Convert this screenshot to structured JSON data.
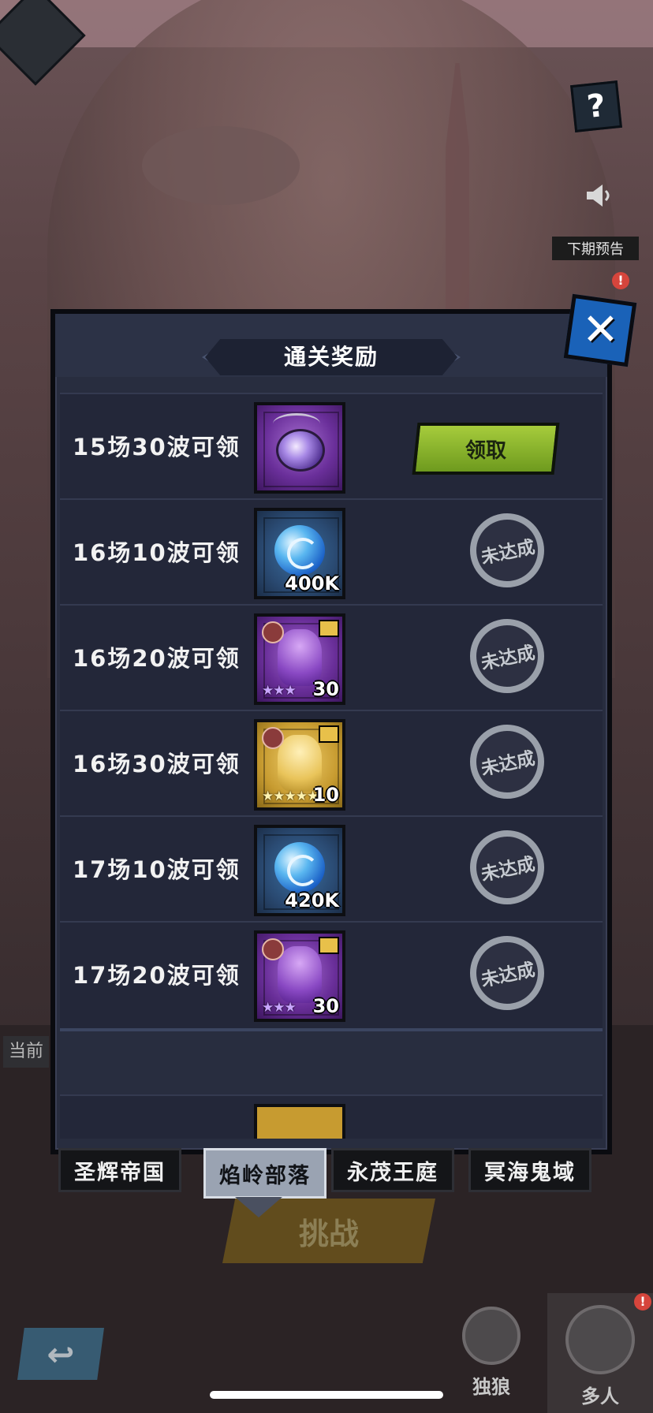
{
  "hud": {
    "help_glyph": "?",
    "preview_icon": "megaphone-icon",
    "preview_label": "下期预告",
    "badge_glyph": "!"
  },
  "modal": {
    "title": "通关奖励",
    "close_glyph": "✕",
    "rewards": [
      {
        "label": "15场30波可领",
        "item": "pendant",
        "frame": "purple",
        "qty": "",
        "status": "claim",
        "action": "领取"
      },
      {
        "label": "16场10波可领",
        "item": "orb",
        "frame": "blue",
        "qty": "400K",
        "status": "locked",
        "action": "未达成"
      },
      {
        "label": "16场20波可领",
        "item": "hero-fragment",
        "frame": "purple",
        "qty": "30",
        "stars": "★★★",
        "status": "locked",
        "action": "未达成"
      },
      {
        "label": "16场30波可领",
        "item": "hero-fragment",
        "frame": "gold",
        "qty": "10",
        "stars": "★★★★★",
        "status": "locked",
        "action": "未达成"
      },
      {
        "label": "17场10波可领",
        "item": "orb",
        "frame": "blue",
        "qty": "420K",
        "status": "locked",
        "action": "未达成"
      },
      {
        "label": "17场20波可领",
        "item": "hero-fragment",
        "frame": "purple",
        "qty": "30",
        "stars": "★★★",
        "status": "locked",
        "action": "未达成"
      }
    ]
  },
  "tabs": [
    {
      "label": "圣辉帝国",
      "active": false
    },
    {
      "label": "焰岭部落",
      "active": true
    },
    {
      "label": "永茂王庭",
      "active": false
    },
    {
      "label": "冥海鬼域",
      "active": false
    }
  ],
  "background_ui": {
    "challenge_label": "挑战",
    "current_label": "当前",
    "back_glyph": "↩",
    "modes": [
      {
        "label": "独狼"
      },
      {
        "label": "多人"
      }
    ]
  },
  "colors": {
    "claim_green": "#8dbb2c",
    "close_blue": "#1a62b8",
    "badge_red": "#d6453c",
    "panel": "#282d3f"
  }
}
